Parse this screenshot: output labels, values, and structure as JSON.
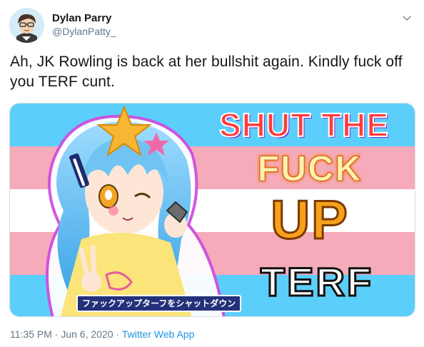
{
  "user": {
    "display_name": "Dylan Parry",
    "handle": "@DylanPatty_"
  },
  "tweet": {
    "text": "Ah, JK Rowling is back at her bullshit again. Kindly fuck off you TERF cunt."
  },
  "media": {
    "headline_line1": "SHUT THE",
    "headline_line2": "FUCK",
    "headline_line3": "UP",
    "headline_line4": "TERF",
    "caption_jp": "ファックアップターフをシャットダウン",
    "flag_colors": [
      "#5bcffa",
      "#f5abb9",
      "#ffffff",
      "#f5abb9",
      "#5bcffa"
    ]
  },
  "meta": {
    "timestamp": "11:35 PM · Jun 6, 2020 · ",
    "source_app": "Twitter Web App"
  },
  "icons": {
    "menu": "chevron-down-icon",
    "avatar": "avatar"
  }
}
